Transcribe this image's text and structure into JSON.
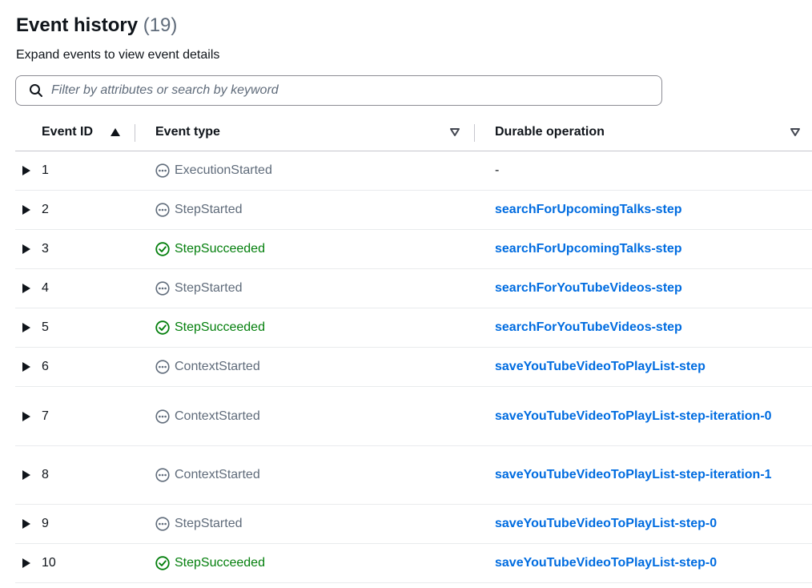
{
  "header": {
    "title": "Event history",
    "count": "(19)",
    "description": "Expand events to view event details"
  },
  "search": {
    "placeholder": "Filter by attributes or search by keyword",
    "value": ""
  },
  "columns": {
    "event_id": "Event ID",
    "event_type": "Event type",
    "durable_operation": "Durable operation"
  },
  "icons": {
    "search": "search-icon",
    "sort_ascending": "caret-up-icon",
    "sort_none": "caret-down-outline-icon",
    "expand": "caret-right-icon",
    "pending": "ellipsis-circle-icon",
    "success": "check-circle-icon"
  },
  "colors": {
    "link": "#006ce0",
    "success": "#037f0c",
    "muted": "#5f6b7a",
    "text": "#0f141a"
  },
  "rows": [
    {
      "id": "1",
      "type": "ExecutionStarted",
      "status": "pending",
      "operation": "-",
      "is_link": false
    },
    {
      "id": "2",
      "type": "StepStarted",
      "status": "pending",
      "operation": "searchForUpcomingTalks-step",
      "is_link": true
    },
    {
      "id": "3",
      "type": "StepSucceeded",
      "status": "success",
      "operation": "searchForUpcomingTalks-step",
      "is_link": true
    },
    {
      "id": "4",
      "type": "StepStarted",
      "status": "pending",
      "operation": "searchForYouTubeVideos-step",
      "is_link": true
    },
    {
      "id": "5",
      "type": "StepSucceeded",
      "status": "success",
      "operation": "searchForYouTubeVideos-step",
      "is_link": true
    },
    {
      "id": "6",
      "type": "ContextStarted",
      "status": "pending",
      "operation": "saveYouTubeVideoToPlayList-step",
      "is_link": true
    },
    {
      "id": "7",
      "type": "ContextStarted",
      "status": "pending",
      "operation": "saveYouTubeVideoToPlayList-step-iteration-0",
      "is_link": true
    },
    {
      "id": "8",
      "type": "ContextStarted",
      "status": "pending",
      "operation": "saveYouTubeVideoToPlayList-step-iteration-1",
      "is_link": true
    },
    {
      "id": "9",
      "type": "StepStarted",
      "status": "pending",
      "operation": "saveYouTubeVideoToPlayList-step-0",
      "is_link": true
    },
    {
      "id": "10",
      "type": "StepSucceeded",
      "status": "success",
      "operation": "saveYouTubeVideoToPlayList-step-0",
      "is_link": true
    }
  ]
}
